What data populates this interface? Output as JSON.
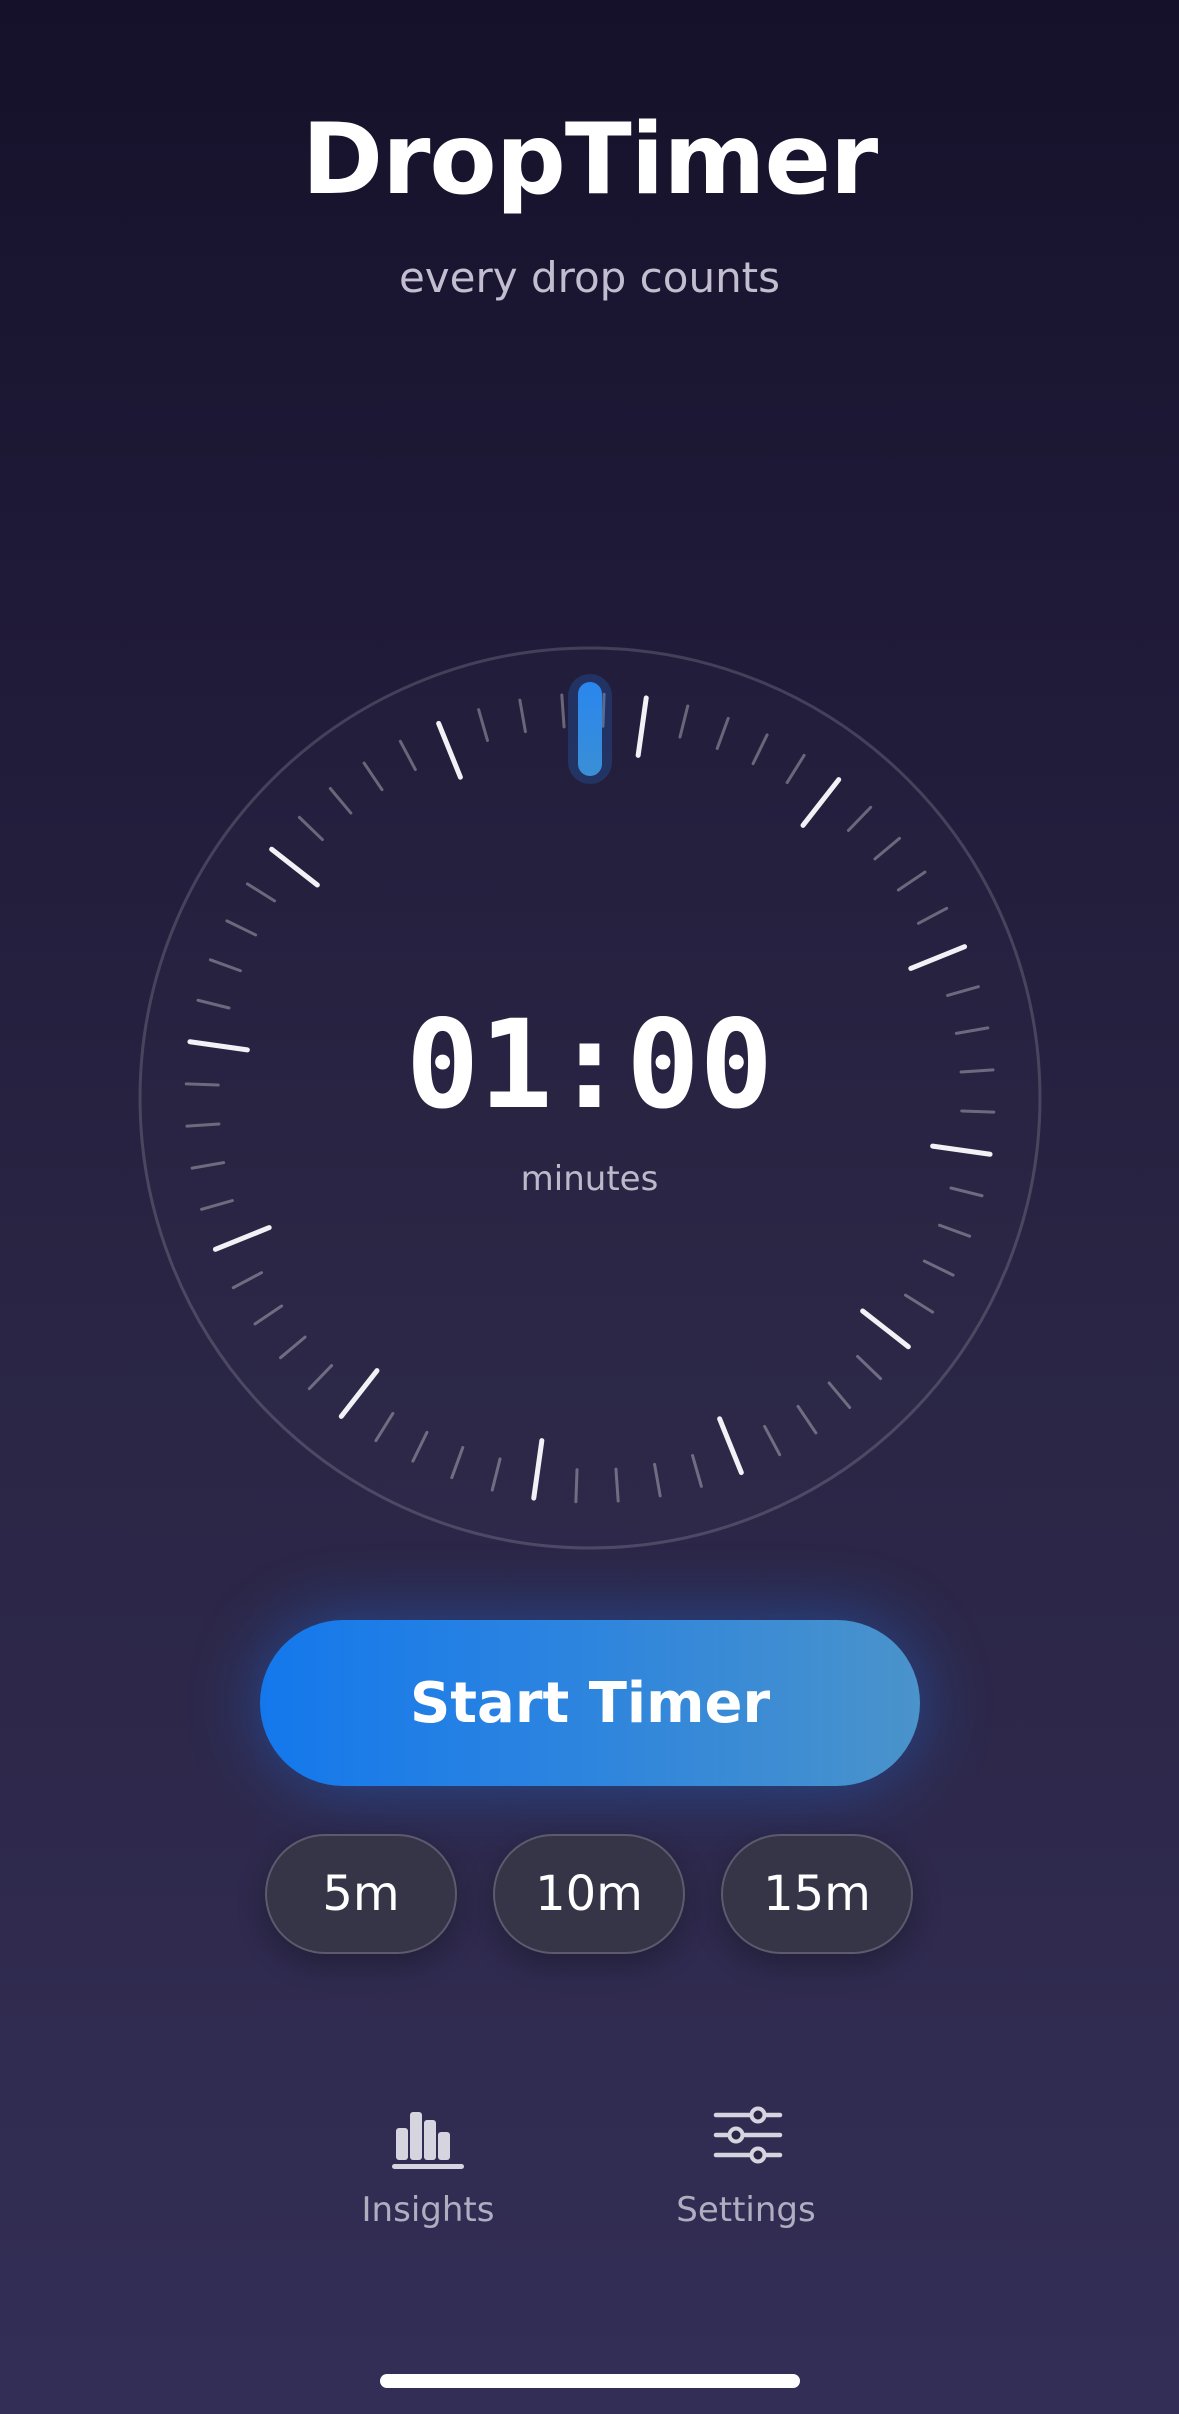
{
  "header": {
    "title": "DropTimer",
    "subtitle": "every drop counts"
  },
  "timer": {
    "time": "01:00",
    "unit": "minutes",
    "progress_fraction": 0,
    "dial_ticks": 60,
    "major_tick_every": 5
  },
  "actions": {
    "start_label": "Start Timer"
  },
  "presets": [
    {
      "label": "5m"
    },
    {
      "label": "10m"
    },
    {
      "label": "15m"
    }
  ],
  "tabbar": {
    "items": [
      {
        "label": "Insights",
        "icon": "bar-chart-icon"
      },
      {
        "label": "Settings",
        "icon": "sliders-icon"
      }
    ]
  },
  "colors": {
    "accent": "#1e7ef0",
    "accent_end": "#4a93cb",
    "chip_bg": "#363447",
    "chip_border": "#5c5a6c",
    "text_muted": "#c2bed0"
  }
}
